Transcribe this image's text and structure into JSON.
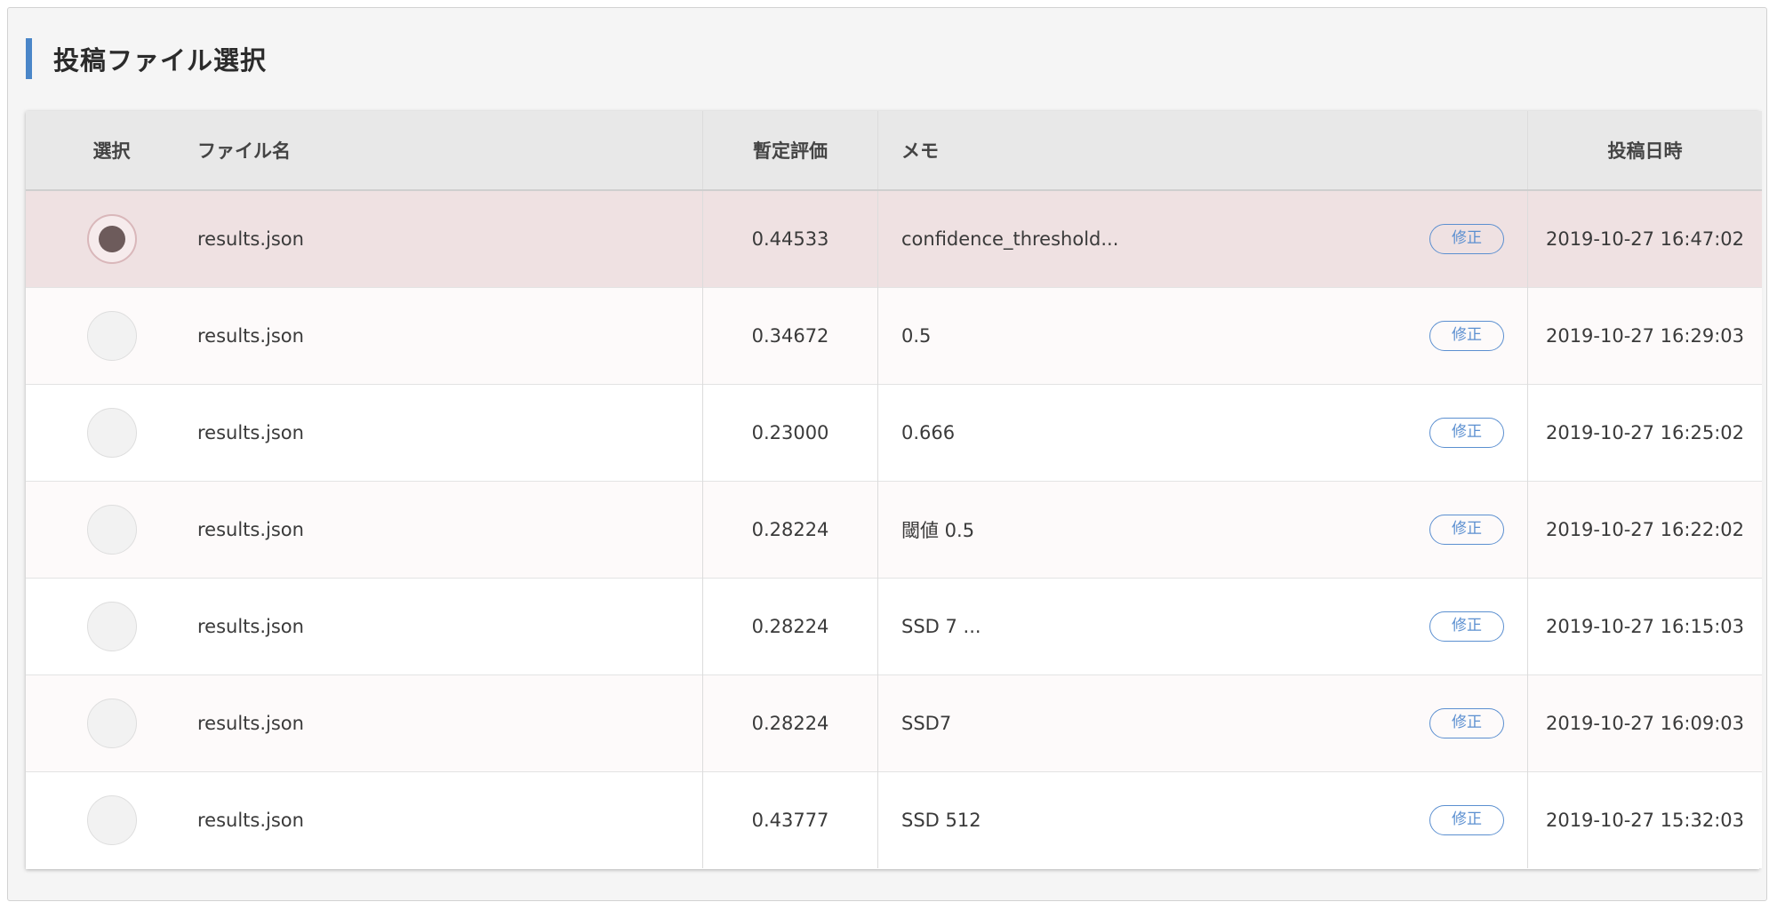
{
  "section": {
    "title": "投稿ファイル選択"
  },
  "table": {
    "headers": {
      "select": "選択",
      "filename": "ファイル名",
      "score": "暫定評価",
      "memo": "メモ",
      "date": "投稿日時"
    },
    "rows": [
      {
        "selected": true,
        "filename": "results.json",
        "score": "0.44533",
        "memo": "confidence_threshold...",
        "edit_label": "修正",
        "date": "2019-10-27 16:47:02"
      },
      {
        "selected": false,
        "filename": "results.json",
        "score": "0.34672",
        "memo": "0.5",
        "edit_label": "修正",
        "date": "2019-10-27 16:29:03"
      },
      {
        "selected": false,
        "filename": "results.json",
        "score": "0.23000",
        "memo": "0.666",
        "edit_label": "修正",
        "date": "2019-10-27 16:25:02"
      },
      {
        "selected": false,
        "filename": "results.json",
        "score": "0.28224",
        "memo": "閾値 0.5",
        "edit_label": "修正",
        "date": "2019-10-27 16:22:02"
      },
      {
        "selected": false,
        "filename": "results.json",
        "score": "0.28224",
        "memo": "SSD 7 ...",
        "edit_label": "修正",
        "date": "2019-10-27 16:15:03"
      },
      {
        "selected": false,
        "filename": "results.json",
        "score": "0.28224",
        "memo": "SSD7",
        "edit_label": "修正",
        "date": "2019-10-27 16:09:03"
      },
      {
        "selected": false,
        "filename": "results.json",
        "score": "0.43777",
        "memo": "SSD 512",
        "edit_label": "修正",
        "date": "2019-10-27 15:32:03"
      }
    ]
  },
  "colors": {
    "accent": "#4a86c8",
    "selected_row": "#efe1e2",
    "edit_button": "#5b8fd0"
  }
}
